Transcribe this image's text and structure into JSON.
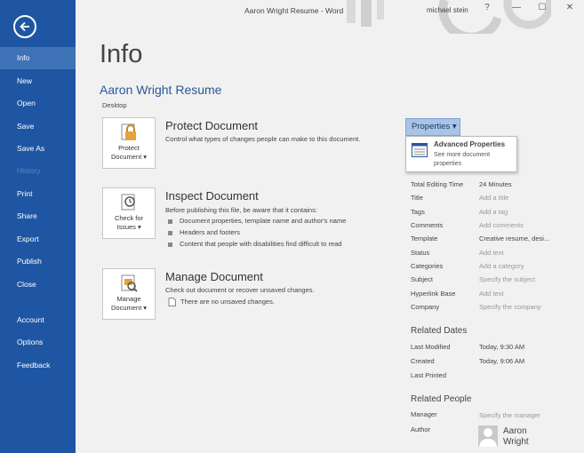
{
  "window": {
    "title": "Aaron Wright Resume - Word",
    "user": "michael stein",
    "help": "?",
    "minimize": "—",
    "restore": "☐",
    "close": "✕"
  },
  "sidebar": {
    "items": [
      {
        "label": "Info"
      },
      {
        "label": "New"
      },
      {
        "label": "Open"
      },
      {
        "label": "Save"
      },
      {
        "label": "Save As"
      },
      {
        "label": "History"
      },
      {
        "label": "Print"
      },
      {
        "label": "Share"
      },
      {
        "label": "Export"
      },
      {
        "label": "Publish"
      },
      {
        "label": "Close"
      },
      {
        "label": "Account"
      },
      {
        "label": "Options"
      },
      {
        "label": "Feedback"
      }
    ]
  },
  "main": {
    "title": "Info",
    "doc_title": "Aaron Wright Resume",
    "doc_location": "Desktop",
    "protect": {
      "button_line1": "Protect",
      "button_line2": "Document ▾",
      "title": "Protect Document",
      "desc": "Control what types of changes people can make to this document."
    },
    "inspect": {
      "button_line1": "Check for",
      "button_line2": "Issues ▾",
      "title": "Inspect Document",
      "desc": "Before publishing this file, be aware that it contains:",
      "bullets": [
        "Document properties, template name and author's name",
        "Headers and footers",
        "Content that people with disabilities find difficult to read"
      ]
    },
    "manage": {
      "button_line1": "Manage",
      "button_line2": "Document ▾",
      "title": "Manage Document",
      "desc": "Check out document or recover unsaved changes.",
      "note": "There are no unsaved changes."
    }
  },
  "properties": {
    "button_label": "Properties ▾",
    "menu": {
      "title": "Advanced Properties",
      "desc": "See more document properties"
    },
    "rows": [
      {
        "label": "Total Editing Time",
        "value": "24 Minutes"
      },
      {
        "label": "Title",
        "value": "Add a title"
      },
      {
        "label": "Tags",
        "value": "Add a tag"
      },
      {
        "label": "Comments",
        "value": "Add comments"
      },
      {
        "label": "Template",
        "value": "Creative resume, desi..."
      },
      {
        "label": "Status",
        "value": "Add text"
      },
      {
        "label": "Categories",
        "value": "Add a category"
      },
      {
        "label": "Subject",
        "value": "Specify the subject"
      },
      {
        "label": "Hyperlink Base",
        "value": "Add text"
      },
      {
        "label": "Company",
        "value": "Specify the company"
      }
    ],
    "related_dates": {
      "heading": "Related Dates",
      "rows": [
        {
          "label": "Last Modified",
          "value": "Today, 9:30 AM"
        },
        {
          "label": "Created",
          "value": "Today, 9:06 AM"
        },
        {
          "label": "Last Printed",
          "value": ""
        }
      ]
    },
    "related_people": {
      "heading": "Related People",
      "manager_label": "Manager",
      "manager_value": "Specify the manager",
      "author_label": "Author",
      "author_first": "Aaron",
      "author_last": "Wright"
    }
  },
  "colors": {
    "sidebar": "#1e56a3",
    "sidebar_active": "#3f73b8",
    "accent_text": "#2b5797",
    "background": "#f1f1f1"
  }
}
